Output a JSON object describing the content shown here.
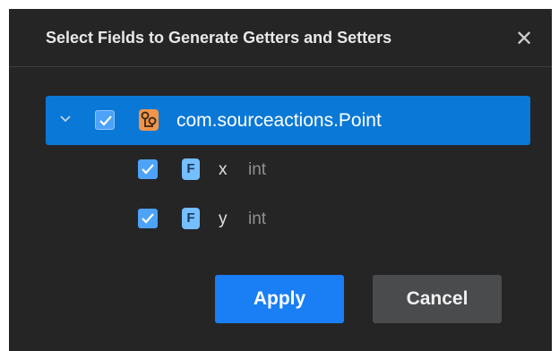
{
  "dialog": {
    "title": "Select Fields to Generate Getters and Setters",
    "close_glyph": "✕"
  },
  "tree": {
    "root": {
      "label": "com.sourceactions.Point",
      "checked": true,
      "expanded": true,
      "icon": "class-icon"
    },
    "fields": [
      {
        "name": "x",
        "type": "int",
        "checked": true,
        "icon_letter": "F"
      },
      {
        "name": "y",
        "type": "int",
        "checked": true,
        "icon_letter": "F"
      }
    ]
  },
  "buttons": {
    "apply_label": "Apply",
    "cancel_label": "Cancel"
  },
  "colors": {
    "background": "#252526",
    "selection": "#0a78d7",
    "checkbox": "#4da3f7",
    "class_icon": "#f0954b",
    "field_icon": "#75beff",
    "apply_button": "#1a7ef5",
    "cancel_button": "#4a4b4d"
  }
}
